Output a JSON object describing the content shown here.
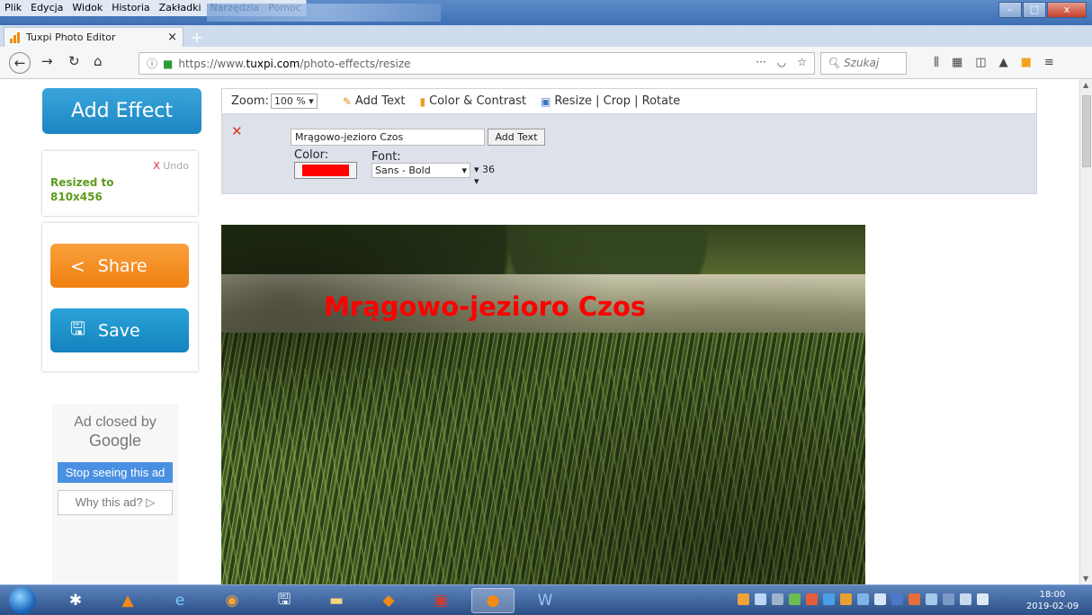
{
  "menu": [
    "Plik",
    "Edycja",
    "Widok",
    "Historia",
    "Zakładki",
    "Narzędzia",
    "Pomoc"
  ],
  "tab": {
    "title": "Tuxpi Photo Editor",
    "close": "×"
  },
  "url": {
    "prefix": "https://www.",
    "host": "tuxpi.com",
    "path": "/photo-effects/resize"
  },
  "search_placeholder": "Szukaj",
  "sidebar": {
    "add_effect": "Add Effect",
    "undo": "Undo",
    "undo_x": "X",
    "resized": "Resized to 810x456",
    "share": "Share",
    "save": "Save"
  },
  "ad": {
    "closed_by": "Ad closed by",
    "google": "Google",
    "stop": "Stop seeing this ad",
    "why": "Why this ad? ▷"
  },
  "editor": {
    "zoom_label": "Zoom:",
    "zoom_value": "100 %",
    "add_text": "Add Text",
    "color_contrast": "Color & Contrast",
    "resize_crop_rotate": "Resize | Crop | Rotate",
    "text_value": "Mrągowo-jezioro Czos",
    "add_text_button": "Add Text",
    "color_label": "Color:",
    "font_label": "Font:",
    "font_value": "Sans - Bold",
    "size_value": "36",
    "text_color": "#ff0000"
  },
  "photo": {
    "overlay_text": "Mrągowo-jezioro Czos"
  },
  "clock": {
    "time": "18:00",
    "date": "2019-02-09"
  }
}
